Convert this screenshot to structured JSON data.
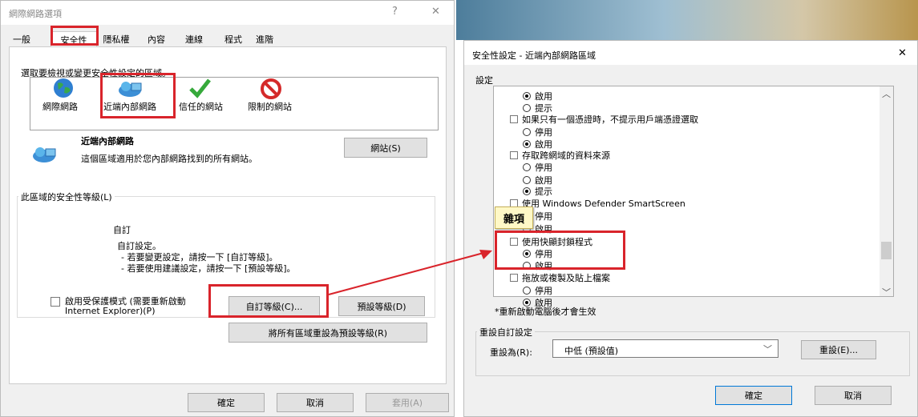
{
  "left": {
    "title": "網際網路選項",
    "title_controls": [
      "?",
      "✕"
    ],
    "tabs": [
      "一般",
      "安全性",
      "隱私權",
      "內容",
      "連線",
      "程式",
      "進階"
    ],
    "zone_prompt": "選取要檢視或變更安全性設定的區域。",
    "zones": [
      "網際網路",
      "近端內部網路",
      "信任的網站",
      "限制的網站"
    ],
    "zone_name": "近端內部網路",
    "zone_desc": "這個區域適用於您內部網路找到的所有網站。",
    "sites_button": "網站(S)",
    "level_group": "此區域的安全性等級(L)",
    "custom_title": "自訂",
    "custom_lines": [
      "自訂設定。",
      "- 若要變更設定，請按一下 [自訂等級]。",
      "- 若要使用建議設定，請按一下 [預設等級]。"
    ],
    "protected_mode_line1": "啟用受保護模式 (需要重新啟動",
    "protected_mode_line2": "Internet Explorer)(P)",
    "custom_level_button": "自訂等級(C)...",
    "default_level_button": "預設等級(D)",
    "reset_all_button": "將所有區域重設為預設等級(R)",
    "ok": "確定",
    "cancel": "取消",
    "apply": "套用(A)"
  },
  "right": {
    "title": "安全性設定 - 近端內部網路區域",
    "close": "✕",
    "settings_label": "設定",
    "items": [
      {
        "kind": "radio",
        "on": true,
        "text": "啟用"
      },
      {
        "kind": "radio",
        "on": false,
        "text": "提示"
      },
      {
        "kind": "check",
        "text": "如果只有一個憑證時，不提示用戶端憑證選取"
      },
      {
        "kind": "radio",
        "on": false,
        "text": "停用"
      },
      {
        "kind": "radio",
        "on": true,
        "text": "啟用"
      },
      {
        "kind": "check",
        "text": "存取跨網域的資料來源"
      },
      {
        "kind": "radio",
        "on": false,
        "text": "停用"
      },
      {
        "kind": "radio",
        "on": false,
        "text": "啟用"
      },
      {
        "kind": "radio",
        "on": true,
        "text": "提示"
      },
      {
        "kind": "check",
        "text": "使用 Windows Defender SmartScreen"
      },
      {
        "kind": "radio",
        "on": false,
        "text": "停用"
      },
      {
        "kind": "radio",
        "on": false,
        "text": "啟用"
      },
      {
        "kind": "check",
        "text": "使用快顯封鎖程式"
      },
      {
        "kind": "radio",
        "on": true,
        "text": "停用"
      },
      {
        "kind": "radio",
        "on": false,
        "text": "啟用"
      },
      {
        "kind": "check",
        "text": "拖放或複製及貼上檔案"
      },
      {
        "kind": "radio",
        "on": false,
        "text": "停用"
      },
      {
        "kind": "radio",
        "on": true,
        "text": "啟用"
      }
    ],
    "category_popup": "雜項",
    "restart_note": "*重新啟動電腦後才會生效",
    "reset_group": "重設自訂設定",
    "reset_label": "重設為(R):",
    "reset_value": "中低 (預設值)",
    "reset_button": "重設(E)...",
    "ok": "確定",
    "cancel": "取消"
  },
  "colors": {
    "highlight": "#d9242b",
    "dialog_bg": "#f0f0f0",
    "accent": "#0078d7"
  }
}
